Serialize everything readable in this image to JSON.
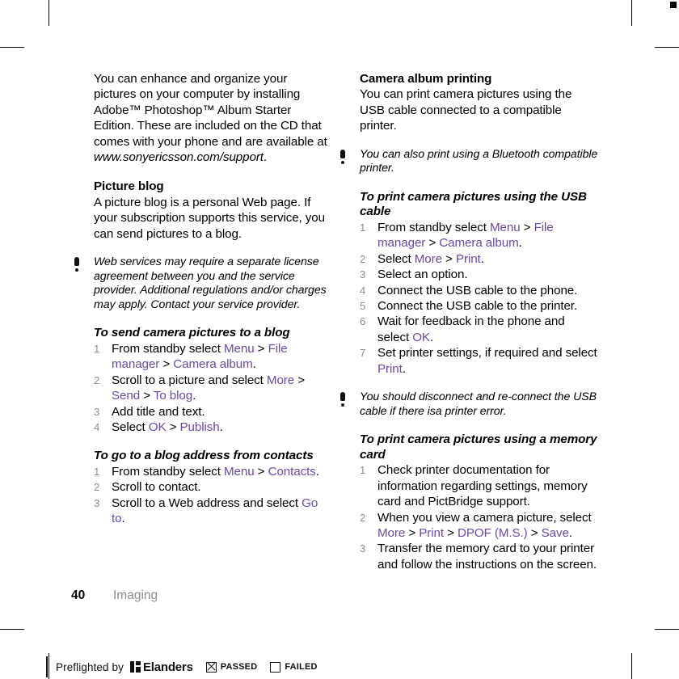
{
  "page": {
    "folio": "40",
    "chapter": "Imaging"
  },
  "left_column": {
    "intro_paragraph": {
      "before_url": "You can enhance and organize your pictures on your computer by installing Adobe™ Photoshop™ Album Starter Edition. These are included on the CD that comes with your phone and are available at ",
      "url": "www.sonyericsson.com/support",
      "after_url": "."
    },
    "picture_blog": {
      "heading": "Picture blog",
      "body": "A picture blog is a personal Web page. If your subscription supports this service, you can send pictures to a blog."
    },
    "note_web_services": "Web services may require a separate license agreement between you and the service provider. Additional regulations and/or charges may apply. Contact your service provider.",
    "procedure_send_to_blog": {
      "heading": "To send camera pictures to a blog",
      "steps": [
        {
          "parts": [
            {
              "text": "From standby select ",
              "style": "plain"
            },
            {
              "text": "Menu",
              "style": "ui"
            },
            {
              "text": " > ",
              "style": "plain"
            },
            {
              "text": "File manager",
              "style": "ui"
            },
            {
              "text": " > ",
              "style": "plain"
            },
            {
              "text": "Camera album",
              "style": "ui"
            },
            {
              "text": ".",
              "style": "plain"
            }
          ]
        },
        {
          "parts": [
            {
              "text": "Scroll to a picture and select ",
              "style": "plain"
            },
            {
              "text": "More",
              "style": "ui"
            },
            {
              "text": " > ",
              "style": "plain"
            },
            {
              "text": "Send",
              "style": "ui"
            },
            {
              "text": " > ",
              "style": "plain"
            },
            {
              "text": "To blog",
              "style": "ui"
            },
            {
              "text": ".",
              "style": "plain"
            }
          ]
        },
        {
          "parts": [
            {
              "text": "Add title and text.",
              "style": "plain"
            }
          ]
        },
        {
          "parts": [
            {
              "text": "Select ",
              "style": "plain"
            },
            {
              "text": "OK",
              "style": "ui"
            },
            {
              "text": " > ",
              "style": "plain"
            },
            {
              "text": "Publish",
              "style": "ui"
            },
            {
              "text": ".",
              "style": "plain"
            }
          ]
        }
      ]
    },
    "procedure_blog_address": {
      "heading": "To go to a blog address from contacts",
      "steps": [
        {
          "parts": [
            {
              "text": "From standby select ",
              "style": "plain"
            },
            {
              "text": "Menu",
              "style": "ui"
            },
            {
              "text": " > ",
              "style": "plain"
            },
            {
              "text": "Contacts",
              "style": "ui"
            },
            {
              "text": ".",
              "style": "plain"
            }
          ]
        },
        {
          "parts": [
            {
              "text": "Scroll to contact.",
              "style": "plain"
            }
          ]
        },
        {
          "parts": [
            {
              "text": "Scroll to a Web address and select ",
              "style": "plain"
            },
            {
              "text": "Go to",
              "style": "ui"
            },
            {
              "text": ".",
              "style": "plain"
            }
          ]
        }
      ]
    }
  },
  "right_column": {
    "camera_album_printing": {
      "heading": "Camera album printing",
      "body": "You can print camera pictures using the USB cable connected to a compatible printer."
    },
    "note_bluetooth": "You can also print using a Bluetooth compatible printer.",
    "procedure_usb": {
      "heading": "To print camera pictures using the USB cable",
      "steps": [
        {
          "parts": [
            {
              "text": "From standby select ",
              "style": "plain"
            },
            {
              "text": "Menu",
              "style": "ui"
            },
            {
              "text": " > ",
              "style": "plain"
            },
            {
              "text": "File manager",
              "style": "ui"
            },
            {
              "text": " > ",
              "style": "plain"
            },
            {
              "text": "Camera album",
              "style": "ui"
            },
            {
              "text": ".",
              "style": "plain"
            }
          ]
        },
        {
          "parts": [
            {
              "text": "Select ",
              "style": "plain"
            },
            {
              "text": "More",
              "style": "ui"
            },
            {
              "text": " > ",
              "style": "plain"
            },
            {
              "text": "Print",
              "style": "ui"
            },
            {
              "text": ".",
              "style": "plain"
            }
          ]
        },
        {
          "parts": [
            {
              "text": "Select an option.",
              "style": "plain"
            }
          ]
        },
        {
          "parts": [
            {
              "text": "Connect the USB cable to the phone.",
              "style": "plain"
            }
          ]
        },
        {
          "parts": [
            {
              "text": "Connect the USB cable to the printer.",
              "style": "plain"
            }
          ]
        },
        {
          "parts": [
            {
              "text": "Wait for feedback in the phone and select ",
              "style": "plain"
            },
            {
              "text": "OK",
              "style": "ui"
            },
            {
              "text": ".",
              "style": "plain"
            }
          ]
        },
        {
          "parts": [
            {
              "text": "Set printer settings, if required and select ",
              "style": "plain"
            },
            {
              "text": "Print",
              "style": "ui"
            },
            {
              "text": ".",
              "style": "plain"
            }
          ]
        }
      ]
    },
    "note_disconnect": "You should disconnect and re-connect the USB cable if there isa printer error.",
    "procedure_memory_card": {
      "heading": "To print camera pictures using a memory card",
      "steps": [
        {
          "parts": [
            {
              "text": "Check printer documentation for information regarding settings, memory card and PictBridge support.",
              "style": "plain"
            }
          ]
        },
        {
          "parts": [
            {
              "text": "When you view a camera picture, select ",
              "style": "plain"
            },
            {
              "text": "More",
              "style": "ui"
            },
            {
              "text": " > ",
              "style": "plain"
            },
            {
              "text": "Print",
              "style": "ui"
            },
            {
              "text": " > ",
              "style": "plain"
            },
            {
              "text": "DPOF (M.S.)",
              "style": "ui"
            },
            {
              "text": " > ",
              "style": "plain"
            },
            {
              "text": "Save",
              "style": "ui"
            },
            {
              "text": ".",
              "style": "plain"
            }
          ]
        },
        {
          "parts": [
            {
              "text": "Transfer the memory card to your printer and follow the instructions on the screen.",
              "style": "plain"
            }
          ]
        }
      ]
    }
  },
  "preflight": {
    "prefix": "Preflighted by",
    "brand": "Elanders",
    "passed_label": "PASSED",
    "failed_label": "FAILED",
    "passed_checked": true,
    "failed_checked": false
  },
  "colors": {
    "ui_reference": "#6b4b9c",
    "step_number": "#8d8d8d",
    "chapter": "#8d8d8d",
    "text": "#000000"
  }
}
